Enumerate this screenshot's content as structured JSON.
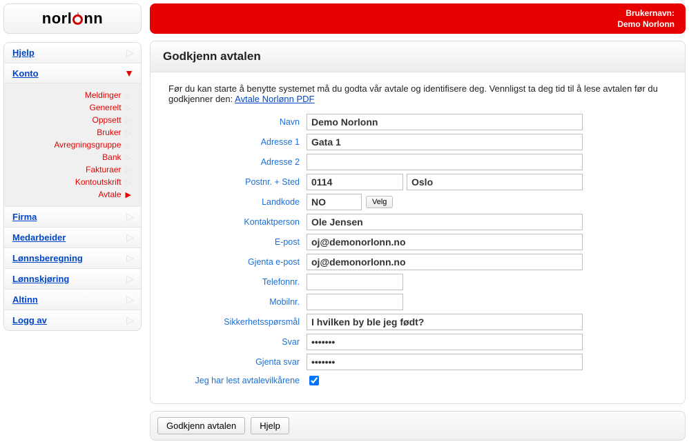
{
  "brand": "norlonn",
  "topbar": {
    "label": "Brukernavn:",
    "username": "Demo Norlonn"
  },
  "nav": {
    "items": [
      {
        "label": "Hjelp",
        "active": false
      },
      {
        "label": "Konto",
        "active": true
      },
      {
        "label": "Firma",
        "active": false
      },
      {
        "label": "Medarbeider",
        "active": false
      },
      {
        "label": "Lønnsberegning",
        "active": false
      },
      {
        "label": "Lønnskjøring",
        "active": false
      },
      {
        "label": "Altinn",
        "active": false
      },
      {
        "label": "Logg av",
        "active": false
      }
    ],
    "sub": [
      {
        "label": "Meldinger",
        "selected": false
      },
      {
        "label": "Generelt",
        "selected": false
      },
      {
        "label": "Oppsett",
        "selected": false
      },
      {
        "label": "Bruker",
        "selected": false
      },
      {
        "label": "Avregningsgruppe",
        "selected": false
      },
      {
        "label": "Bank",
        "selected": false
      },
      {
        "label": "Fakturaer",
        "selected": false
      },
      {
        "label": "Kontoutskrift",
        "selected": false
      },
      {
        "label": "Avtale",
        "selected": true
      }
    ]
  },
  "panel": {
    "title": "Godkjenn avtalen",
    "intro_a": "Før du kan starte å benytte systemet må du godta vår avtale og identifisere deg. Vennligst ta deg tid til å lese avtalen før du godkjenner den: ",
    "intro_link": "Avtale Norlønn PDF"
  },
  "form": {
    "labels": {
      "navn": "Navn",
      "adr1": "Adresse 1",
      "adr2": "Adresse 2",
      "postnr": "Postnr. + Sted",
      "landkode": "Landkode",
      "kontakt": "Kontaktperson",
      "epost": "E-post",
      "epost2": "Gjenta e-post",
      "tel": "Telefonnr.",
      "mob": "Mobilnr.",
      "spm": "Sikkerhetsspørsmål",
      "svar": "Svar",
      "svar2": "Gjenta svar",
      "chk": "Jeg har lest avtalevilkårene"
    },
    "values": {
      "navn": "Demo Norlonn",
      "adr1": "Gata 1",
      "adr2": "",
      "postnr": "0114",
      "sted": "Oslo",
      "landkode": "NO",
      "velg": "Velg",
      "kontakt": "Ole Jensen",
      "epost": "oj@demonorlonn.no",
      "epost2": "oj@demonorlonn.no",
      "tel": "",
      "mob": "",
      "spm": "I hvilken by ble jeg født?",
      "svar": "•••••••",
      "svar2": "•••••••",
      "checked": true
    }
  },
  "footer": {
    "approve": "Godkjenn avtalen",
    "help": "Hjelp"
  }
}
